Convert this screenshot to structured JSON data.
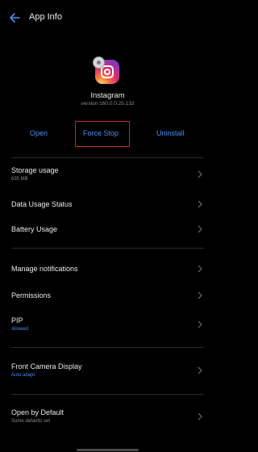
{
  "header": {
    "title": "App Info",
    "back_icon": "arrow-left-icon"
  },
  "app": {
    "name": "Instagram",
    "version": "version 160.0.0.25.132",
    "icon": "instagram-icon",
    "badge_icon": "gear-badge-icon"
  },
  "actions": {
    "open": "Open",
    "force_stop": "Force Stop",
    "uninstall": "Uninstall",
    "accent_color": "#4b8cf0",
    "highlight_color": "#d42020"
  },
  "settings": [
    {
      "title": "Storage usage",
      "subtitle": "635 MB"
    },
    {
      "title": "Data Usage Status",
      "subtitle": ""
    },
    {
      "title": "Battery Usage",
      "subtitle": ""
    },
    {
      "title": "Manage notifications",
      "subtitle": ""
    },
    {
      "title": "Permissions",
      "subtitle": ""
    },
    {
      "title": "PIP",
      "subtitle": "Allowed"
    },
    {
      "title": "Front Camera Display",
      "subtitle": "Auto adapt"
    },
    {
      "title": "Open by Default",
      "subtitle": "Some defaults set"
    }
  ]
}
